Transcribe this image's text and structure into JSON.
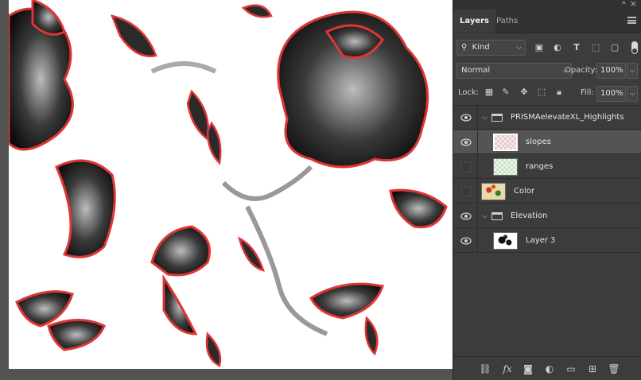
{
  "panel": {
    "collapse_glyph": "«",
    "close_glyph": "×",
    "tabs": [
      {
        "label": "Layers",
        "active": true
      },
      {
        "label": "Paths",
        "active": false
      }
    ]
  },
  "filter": {
    "kind_label": "Kind",
    "icons": [
      "image-filter-icon",
      "adjustment-filter-icon",
      "type-filter-icon",
      "shape-filter-icon",
      "smart-object-filter-icon"
    ]
  },
  "blend": {
    "mode": "Normal",
    "opacity_label": "Opacity:",
    "opacity": "100%"
  },
  "lock": {
    "label": "Lock:",
    "fill_label": "Fill:",
    "fill": "100%"
  },
  "layers": [
    {
      "name": "PRISMAelevateXL_Highlights",
      "type": "group",
      "visible": true,
      "expanded": true,
      "indent": 0
    },
    {
      "name": "slopes",
      "type": "layer",
      "visible": true,
      "selected": true,
      "indent": 1,
      "thumb": "checker-red"
    },
    {
      "name": "ranges",
      "type": "layer",
      "visible": false,
      "indent": 1,
      "thumb": "checker-green"
    },
    {
      "name": "Color",
      "type": "layer",
      "visible": false,
      "indent": 0,
      "thumb": "floral"
    },
    {
      "name": "Elevation",
      "type": "group",
      "visible": true,
      "expanded": true,
      "indent": 0
    },
    {
      "name": "Layer 3",
      "type": "layer",
      "visible": true,
      "indent": 1,
      "thumb": "bw"
    }
  ],
  "bottom_icons": [
    "link-layers-icon",
    "fx-icon",
    "add-mask-icon",
    "adjustment-layer-icon",
    "new-group-icon",
    "new-layer-icon",
    "delete-layer-icon"
  ],
  "colors": {
    "panel_bg": "#3c3c3c",
    "selected_row": "#545454",
    "outline_red": "#e03535"
  }
}
